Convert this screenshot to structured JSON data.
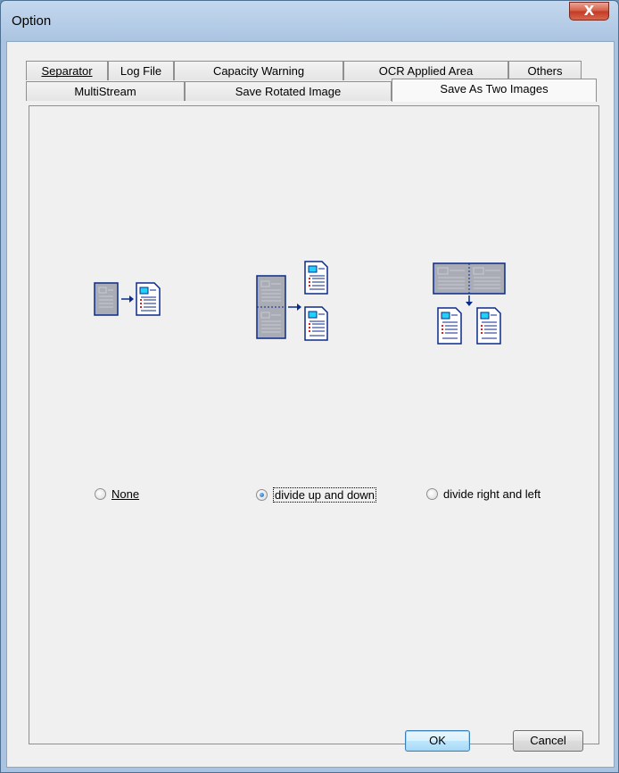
{
  "window": {
    "title": "Option",
    "close_glyph": "X"
  },
  "tabs": {
    "row1": [
      {
        "label": "Separator",
        "mnemonic": "S"
      },
      {
        "label": "Log File"
      },
      {
        "label": "Capacity Warning"
      },
      {
        "label": "OCR Applied Area"
      },
      {
        "label": "Others"
      }
    ],
    "row2": [
      {
        "label": "MultiStream"
      },
      {
        "label": "Save Rotated Image"
      },
      {
        "label": "Save As Two Images",
        "active": true
      }
    ]
  },
  "options": [
    {
      "label": "None",
      "checked": false,
      "icon": "single-page-to-single-page-icon"
    },
    {
      "label": "divide up and down",
      "checked": true,
      "icon": "split-vertical-icon"
    },
    {
      "label": "divide right and left",
      "checked": false,
      "icon": "split-horizontal-icon"
    }
  ],
  "buttons": {
    "ok": "OK",
    "cancel": "Cancel"
  },
  "colors": {
    "accent_blue": "#0b2a8a",
    "icon_cyan": "#1ed3f5",
    "page_gray": "#a9acb5"
  }
}
